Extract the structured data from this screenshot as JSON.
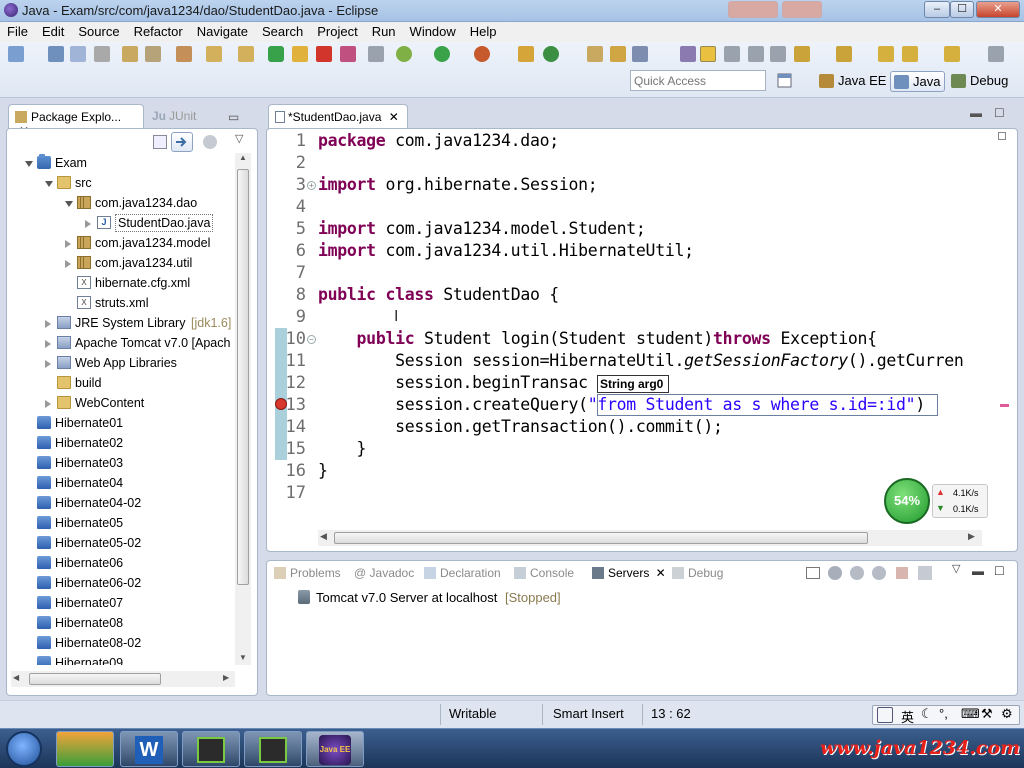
{
  "window": {
    "title": "Java - Exam/src/com/java1234/dao/StudentDao.java - Eclipse",
    "buttons": {
      "minimize": "–",
      "maximize": "☐",
      "close": "✕"
    }
  },
  "menu": [
    "File",
    "Edit",
    "Source",
    "Refactor",
    "Navigate",
    "Search",
    "Project",
    "Run",
    "Window",
    "Help"
  ],
  "quick_access": {
    "placeholder": "Quick Access"
  },
  "perspectives": [
    {
      "label": "Java EE",
      "active": false
    },
    {
      "label": "Java",
      "active": true
    },
    {
      "label": "Debug",
      "active": false
    }
  ],
  "package_explorer": {
    "tabs": [
      "Package Explo...",
      "JUnit"
    ],
    "tree": [
      {
        "label": "Exam",
        "icon": "project-icon",
        "level": 0,
        "expanded": true
      },
      {
        "label": "src",
        "icon": "source-folder-icon",
        "level": 1,
        "expanded": true
      },
      {
        "label": "com.java1234.dao",
        "icon": "package-icon",
        "level": 2,
        "expanded": true
      },
      {
        "label": "StudentDao.java",
        "icon": "java-file-icon",
        "level": 3,
        "expanded": false,
        "selected": true
      },
      {
        "label": "com.java1234.model",
        "icon": "package-icon",
        "level": 2,
        "expanded": false
      },
      {
        "label": "com.java1234.util",
        "icon": "package-icon",
        "level": 2,
        "expanded": false
      },
      {
        "label": "hibernate.cfg.xml",
        "icon": "xml-file-icon",
        "level": 2,
        "leaf": true
      },
      {
        "label": "struts.xml",
        "icon": "xml-file-icon",
        "level": 2,
        "leaf": true
      },
      {
        "label": "JRE System Library",
        "suffix": "[jdk1.6]",
        "icon": "library-icon",
        "level": 1,
        "expanded": false
      },
      {
        "label": "Apache Tomcat v7.0 [Apach",
        "icon": "library-icon",
        "level": 1,
        "expanded": false
      },
      {
        "label": "Web App Libraries",
        "icon": "library-icon",
        "level": 1,
        "expanded": false
      },
      {
        "label": "build",
        "icon": "folder-icon",
        "level": 1,
        "leaf": true
      },
      {
        "label": "WebContent",
        "icon": "folder-icon",
        "level": 1,
        "expanded": false
      },
      {
        "label": "Hibernate01",
        "icon": "project-folder-icon",
        "level": 0,
        "leaf": true
      },
      {
        "label": "Hibernate02",
        "icon": "project-folder-icon",
        "level": 0,
        "leaf": true
      },
      {
        "label": "Hibernate03",
        "icon": "project-folder-icon",
        "level": 0,
        "leaf": true
      },
      {
        "label": "Hibernate04",
        "icon": "project-folder-icon",
        "level": 0,
        "leaf": true
      },
      {
        "label": "Hibernate04-02",
        "icon": "project-folder-icon",
        "level": 0,
        "leaf": true
      },
      {
        "label": "Hibernate05",
        "icon": "project-folder-icon",
        "level": 0,
        "leaf": true
      },
      {
        "label": "Hibernate05-02",
        "icon": "project-folder-icon",
        "level": 0,
        "leaf": true
      },
      {
        "label": "Hibernate06",
        "icon": "project-folder-icon",
        "level": 0,
        "leaf": true
      },
      {
        "label": "Hibernate06-02",
        "icon": "project-folder-icon",
        "level": 0,
        "leaf": true
      },
      {
        "label": "Hibernate07",
        "icon": "project-folder-icon",
        "level": 0,
        "leaf": true
      },
      {
        "label": "Hibernate08",
        "icon": "project-folder-icon",
        "level": 0,
        "leaf": true
      },
      {
        "label": "Hibernate08-02",
        "icon": "project-folder-icon",
        "level": 0,
        "leaf": true
      },
      {
        "label": "Hibernate09",
        "icon": "project-folder-icon",
        "level": 0,
        "leaf": true
      }
    ]
  },
  "editor": {
    "tab_label": "*StudentDao.java",
    "lines": [
      {
        "n": "1",
        "tokens": [
          [
            "kw",
            "package"
          ],
          [
            "t",
            " com.java1234.dao;"
          ]
        ]
      },
      {
        "n": "2",
        "tokens": []
      },
      {
        "n": "3",
        "tokens": [
          [
            "kw",
            "import"
          ],
          [
            "t",
            " org.hibernate.Session;"
          ]
        ],
        "fold": "+"
      },
      {
        "n": "4",
        "tokens": []
      },
      {
        "n": "5",
        "tokens": [
          [
            "kw",
            "import"
          ],
          [
            "t",
            " com.java1234.model.Student;"
          ]
        ]
      },
      {
        "n": "6",
        "tokens": [
          [
            "kw",
            "import"
          ],
          [
            "t",
            " com.java1234.util.HibernateUtil;"
          ]
        ]
      },
      {
        "n": "7",
        "tokens": []
      },
      {
        "n": "8",
        "tokens": [
          [
            "kw",
            "public"
          ],
          [
            "t",
            " "
          ],
          [
            "kw",
            "class"
          ],
          [
            "t",
            " StudentDao {"
          ]
        ]
      },
      {
        "n": "9",
        "tokens": []
      },
      {
        "n": "10",
        "tokens": [
          [
            "t",
            "    "
          ],
          [
            "kw",
            "public"
          ],
          [
            "t",
            " Student login(Student student)"
          ],
          [
            "kw",
            "throws"
          ],
          [
            "t",
            " Exception{"
          ]
        ],
        "fold": "−",
        "changed": true
      },
      {
        "n": "11",
        "tokens": [
          [
            "t",
            "        Session session=HibernateUtil."
          ],
          [
            "it",
            "getSessionFactory"
          ],
          [
            "t",
            "().getCurren"
          ]
        ],
        "changed": true
      },
      {
        "n": "12",
        "tokens": [
          [
            "t",
            "        session.beginTransac"
          ]
        ],
        "changed": true
      },
      {
        "n": "13",
        "tokens": [
          [
            "t",
            "        session.createQuery("
          ],
          [
            "str",
            "\"from Student as s where s.id=:id\""
          ],
          [
            "t",
            ")"
          ]
        ],
        "changed": true,
        "error": true
      },
      {
        "n": "14",
        "tokens": [
          [
            "t",
            "        session.getTransaction().commit();"
          ]
        ],
        "changed": true
      },
      {
        "n": "15",
        "tokens": [
          [
            "t",
            "    }"
          ]
        ],
        "changed": true
      },
      {
        "n": "16",
        "tokens": [
          [
            "t",
            "}"
          ]
        ]
      },
      {
        "n": "17",
        "tokens": []
      }
    ],
    "param_hint": "String arg0"
  },
  "net_monitor": {
    "percent": "54%",
    "up": "4.1K/s",
    "down": "0.1K/s"
  },
  "bottom_panel": {
    "tabs": [
      "Problems",
      "@ Javadoc",
      "Declaration",
      "Console",
      "Servers",
      "Debug"
    ],
    "active_tab": "Servers",
    "servers": [
      {
        "name": "Tomcat v7.0 Server at localhost",
        "state": "[Stopped]"
      }
    ]
  },
  "status": {
    "writable": "Writable",
    "insert_mode": "Smart Insert",
    "position": "13 : 62"
  },
  "ime": {
    "lang": "英"
  },
  "watermark": "www.java1234.com",
  "colors": {
    "keyword": "#7f0055",
    "string": "#2a00ff",
    "line_number": "#6e6e6e",
    "change_bar": "#7fb5c5",
    "accent": "#3a6ea5"
  }
}
